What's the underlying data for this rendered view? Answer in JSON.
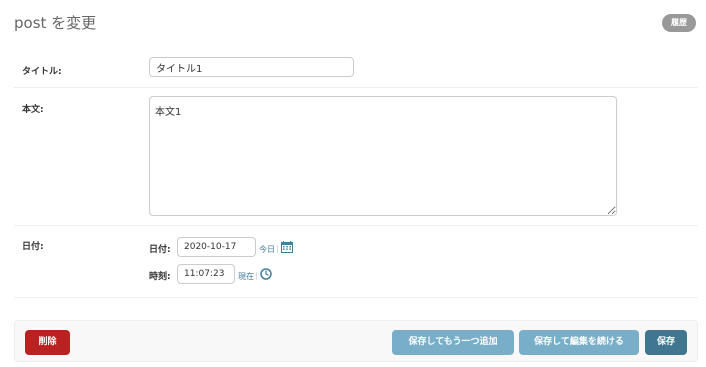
{
  "header": {
    "title": "post を変更",
    "history_label": "履歴"
  },
  "fields": {
    "title": {
      "label": "タイトル:",
      "value": "タイトル1"
    },
    "body": {
      "label": "本文:",
      "value": "本文1"
    },
    "date": {
      "label": "日付:",
      "date_label": "日付:",
      "date_value": "2020-10-17",
      "today_label": "今日",
      "time_label": "時刻:",
      "time_value": "11:07:23",
      "now_label": "現在",
      "separator": "|"
    }
  },
  "actions": {
    "delete_label": "削除",
    "save_add_another_label": "保存してもう一つ追加",
    "save_continue_label": "保存して編集を続ける",
    "save_label": "保存"
  },
  "icons": {
    "calendar": "calendar-icon",
    "clock": "clock-icon"
  },
  "colors": {
    "delete": "#ba2121",
    "secondary": "#79aec8",
    "primary": "#417690",
    "link": "#447e9b",
    "history": "#999999"
  }
}
